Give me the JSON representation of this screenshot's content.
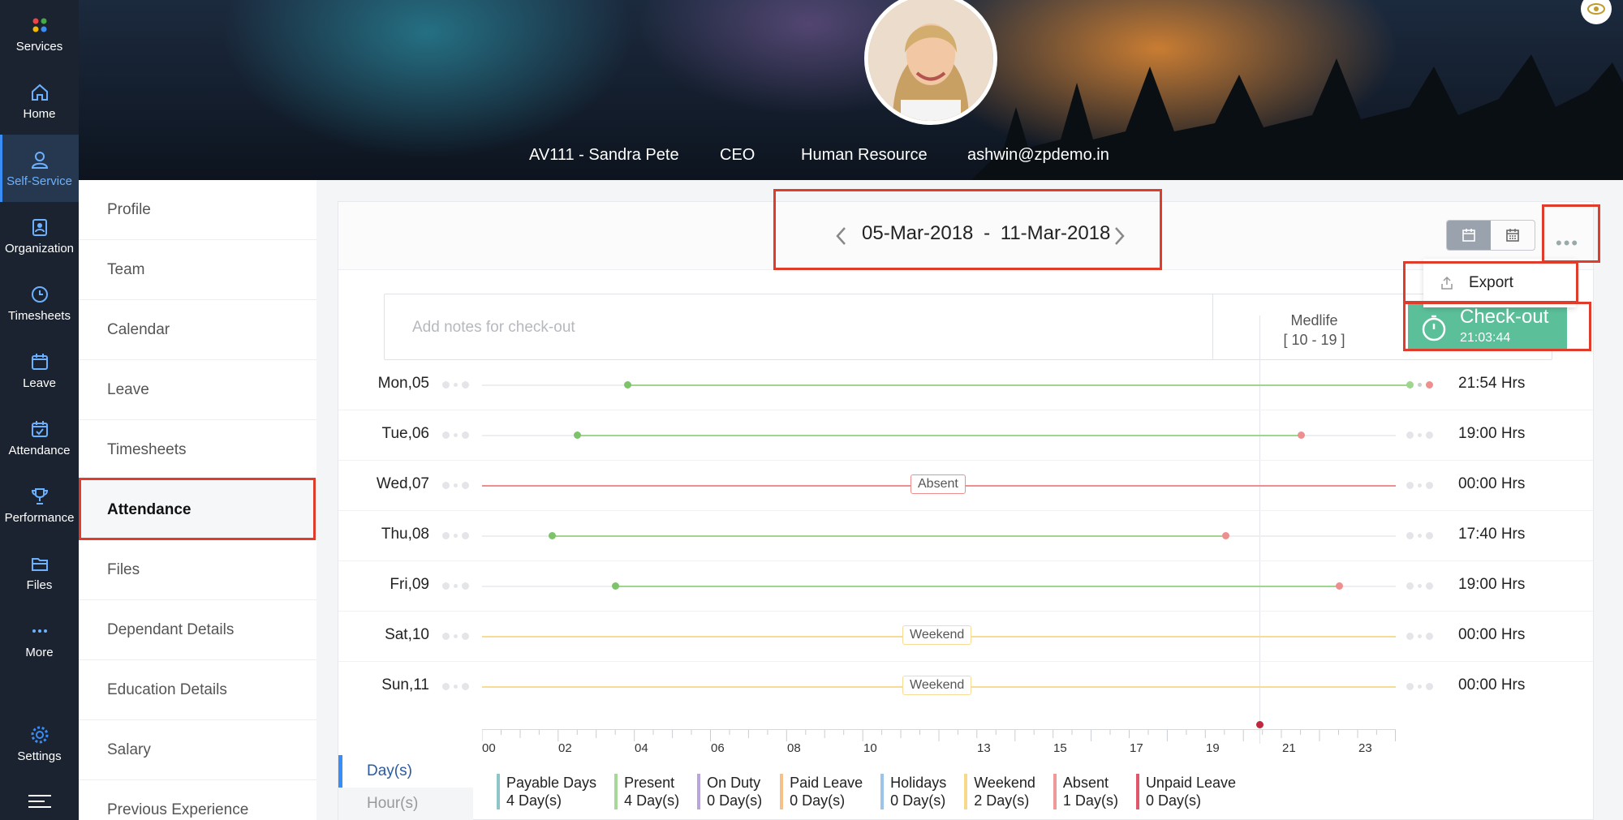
{
  "rail": [
    {
      "name": "services",
      "label": "Services",
      "icon": "services-icon"
    },
    {
      "name": "home",
      "label": "Home",
      "icon": "home-icon"
    },
    {
      "name": "self-service",
      "label": "Self-Service",
      "icon": "user-icon",
      "active": true
    },
    {
      "name": "organization",
      "label": "Organization",
      "icon": "organization-icon"
    },
    {
      "name": "timesheets",
      "label": "Timesheets",
      "icon": "clock-icon"
    },
    {
      "name": "leave",
      "label": "Leave",
      "icon": "calendar-icon"
    },
    {
      "name": "attendance",
      "label": "Attendance",
      "icon": "calendar-check-icon"
    },
    {
      "name": "performance",
      "label": "Performance",
      "icon": "trophy-icon"
    },
    {
      "name": "files",
      "label": "Files",
      "icon": "folder-icon"
    },
    {
      "name": "more",
      "label": "More",
      "icon": "ellipsis-icon"
    },
    {
      "name": "settings",
      "label": "Settings",
      "icon": "gear-icon"
    }
  ],
  "profile": {
    "id_name": "AV111 - Sandra Pete",
    "role": "CEO",
    "department": "Human Resource",
    "email": "ashwin@zpdemo.in"
  },
  "subnav": [
    "Profile",
    "Team",
    "Calendar",
    "Leave",
    "Timesheets",
    "Attendance",
    "Files",
    "Dependant Details",
    "Education Details",
    "Salary",
    "Previous Experience"
  ],
  "subnav_active": "Attendance",
  "header": {
    "range_start": "05-Mar-2018",
    "range_sep": "-",
    "range_end": "11-Mar-2018",
    "more": "•••"
  },
  "menu": {
    "export": "Export"
  },
  "notes": {
    "placeholder": "Add notes for check-out"
  },
  "shift": {
    "name": "Medlife",
    "hours": "[ 10 - 19 ]"
  },
  "checkout": {
    "label": "Check-out",
    "time": "21:03:44"
  },
  "days": [
    {
      "label": "Mon,05",
      "hours": "21:54 Hrs"
    },
    {
      "label": "Tue,06",
      "hours": "19:00 Hrs"
    },
    {
      "label": "Wed,07",
      "hours": "00:00 Hrs",
      "tag": "Absent"
    },
    {
      "label": "Thu,08",
      "hours": "17:40 Hrs"
    },
    {
      "label": "Fri,09",
      "hours": "19:00 Hrs"
    },
    {
      "label": "Sat,10",
      "hours": "00:00 Hrs",
      "tag": "Weekend"
    },
    {
      "label": "Sun,11",
      "hours": "00:00 Hrs",
      "tag": "Weekend"
    }
  ],
  "axis_ticks": [
    "00",
    "02",
    "04",
    "06",
    "08",
    "10",
    "13",
    "15",
    "17",
    "19",
    "21",
    "23"
  ],
  "legend_tabs": [
    "Day(s)",
    "Hour(s)"
  ],
  "legend": [
    {
      "label": "Payable Days",
      "value": "4 Day(s)",
      "color": "#8ec5c6"
    },
    {
      "label": "Present",
      "value": "4 Day(s)",
      "color": "#a6d89a"
    },
    {
      "label": "On Duty",
      "value": "0 Day(s)",
      "color": "#b7a6dc"
    },
    {
      "label": "Paid Leave",
      "value": "0 Day(s)",
      "color": "#f5c089"
    },
    {
      "label": "Holidays",
      "value": "0 Day(s)",
      "color": "#9ac4ea"
    },
    {
      "label": "Weekend",
      "value": "2 Day(s)",
      "color": "#f7d98a"
    },
    {
      "label": "Absent",
      "value": "1 Day(s)",
      "color": "#ef9a9a"
    },
    {
      "label": "Unpaid Leave",
      "value": "0 Day(s)",
      "color": "#e0566a"
    }
  ],
  "colors": {
    "present": "#9fd68e",
    "absent": "#ef8e8e",
    "weekend": "#f8dc95",
    "checkout": "#5bbf9a",
    "accent": "#3a8df5",
    "highlight": "#e03c2c"
  }
}
